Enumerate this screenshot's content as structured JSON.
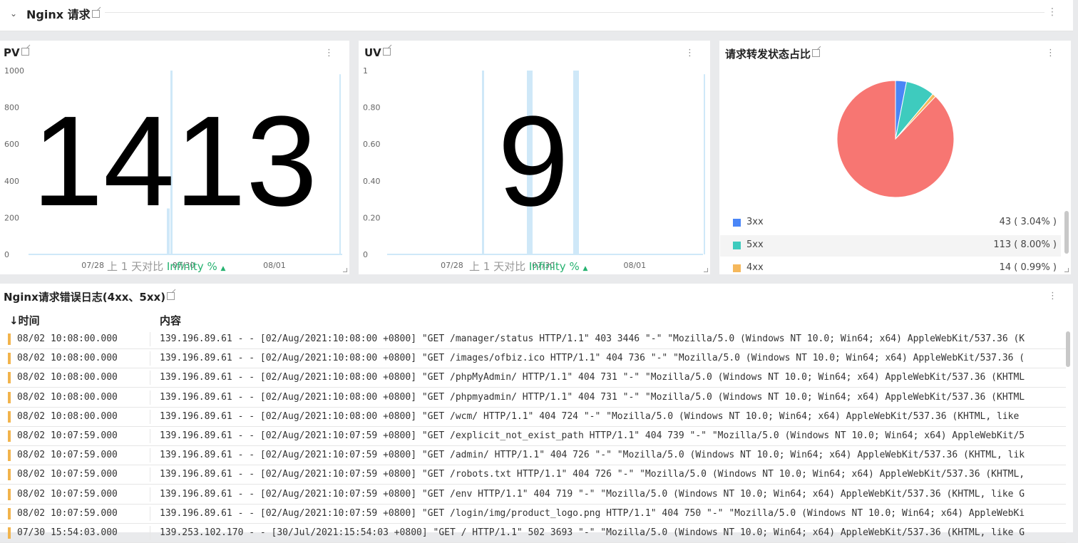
{
  "section": {
    "title": "Nginx 请求"
  },
  "pv_panel": {
    "title": "PV",
    "stat": "1413",
    "y_ticks": [
      "1000",
      "800",
      "600",
      "400",
      "200",
      "0"
    ],
    "x_ticks": [
      "07/28",
      "07/30",
      "08/01"
    ],
    "compare_label": "上 1 天对比",
    "compare_value": "Infinity %",
    "compare_arrow": "▲"
  },
  "uv_panel": {
    "title": "UV",
    "stat": "9",
    "y_ticks": [
      "1",
      "0.80",
      "0.60",
      "0.40",
      "0.20",
      "0"
    ],
    "x_ticks": [
      "07/28",
      "07/30",
      "08/01"
    ],
    "compare_label": "上 1 天对比",
    "compare_value": "Infinity %",
    "compare_arrow": "▲"
  },
  "pie_panel": {
    "title": "请求转发状态占比",
    "legend": [
      {
        "name": "3xx",
        "value": "43 ( 3.04% )",
        "color": "#4a86f7"
      },
      {
        "name": "5xx",
        "value": "113 ( 8.00% )",
        "color": "#3ecbbe"
      },
      {
        "name": "4xx",
        "value": "14 ( 0.99% )",
        "color": "#f5b85c"
      }
    ]
  },
  "chart_data": {
    "type": "pie",
    "slices": [
      {
        "name": "3xx",
        "value": 3.04,
        "color": "#4a86f7"
      },
      {
        "name": "5xx",
        "value": 8.0,
        "color": "#3ecbbe"
      },
      {
        "name": "4xx",
        "value": 0.99,
        "color": "#f5b85c"
      },
      {
        "value": 87.97,
        "color": "#f77672"
      }
    ]
  },
  "log_panel": {
    "title": "Nginx请求错误日志(4xx、5xx)",
    "col_time": "↓时间",
    "col_content": "内容",
    "rows": [
      {
        "time": "08/02 10:08:00.000",
        "content": "139.196.89.61 - - [02/Aug/2021:10:08:00 +0800] \"GET /manager/status HTTP/1.1\" 403 3446 \"-\" \"Mozilla/5.0 (Windows NT 10.0; Win64; x64) AppleWebKit/537.36 (K"
      },
      {
        "time": "08/02 10:08:00.000",
        "content": "139.196.89.61 - - [02/Aug/2021:10:08:00 +0800] \"GET /images/ofbiz.ico HTTP/1.1\" 404 736 \"-\" \"Mozilla/5.0 (Windows NT 10.0; Win64; x64) AppleWebKit/537.36 ("
      },
      {
        "time": "08/02 10:08:00.000",
        "content": "139.196.89.61 - - [02/Aug/2021:10:08:00 +0800] \"GET /phpMyAdmin/ HTTP/1.1\" 404 731 \"-\" \"Mozilla/5.0 (Windows NT 10.0; Win64; x64) AppleWebKit/537.36 (KHTML"
      },
      {
        "time": "08/02 10:08:00.000",
        "content": "139.196.89.61 - - [02/Aug/2021:10:08:00 +0800] \"GET /phpmyadmin/ HTTP/1.1\" 404 731 \"-\" \"Mozilla/5.0 (Windows NT 10.0; Win64; x64) AppleWebKit/537.36 (KHTML"
      },
      {
        "time": "08/02 10:08:00.000",
        "content": "139.196.89.61 - - [02/Aug/2021:10:08:00 +0800] \"GET /wcm/ HTTP/1.1\" 404 724 \"-\" \"Mozilla/5.0 (Windows NT 10.0; Win64; x64) AppleWebKit/537.36 (KHTML, like"
      },
      {
        "time": "08/02 10:07:59.000",
        "content": "139.196.89.61 - - [02/Aug/2021:10:07:59 +0800] \"GET /explicit_not_exist_path HTTP/1.1\" 404 739 \"-\" \"Mozilla/5.0 (Windows NT 10.0; Win64; x64) AppleWebKit/5"
      },
      {
        "time": "08/02 10:07:59.000",
        "content": "139.196.89.61 - - [02/Aug/2021:10:07:59 +0800] \"GET /admin/ HTTP/1.1\" 404 726 \"-\" \"Mozilla/5.0 (Windows NT 10.0; Win64; x64) AppleWebKit/537.36 (KHTML, lik"
      },
      {
        "time": "08/02 10:07:59.000",
        "content": "139.196.89.61 - - [02/Aug/2021:10:07:59 +0800] \"GET /robots.txt HTTP/1.1\" 404 726 \"-\" \"Mozilla/5.0 (Windows NT 10.0; Win64; x64) AppleWebKit/537.36 (KHTML,"
      },
      {
        "time": "08/02 10:07:59.000",
        "content": "139.196.89.61 - - [02/Aug/2021:10:07:59 +0800] \"GET /env HTTP/1.1\" 404 719 \"-\" \"Mozilla/5.0 (Windows NT 10.0; Win64; x64) AppleWebKit/537.36 (KHTML, like G"
      },
      {
        "time": "08/02 10:07:59.000",
        "content": "139.196.89.61 - - [02/Aug/2021:10:07:59 +0800] \"GET /login/img/product_logo.png HTTP/1.1\" 404 750 \"-\" \"Mozilla/5.0 (Windows NT 10.0; Win64; x64) AppleWebKi"
      },
      {
        "time": "07/30 15:54:03.000",
        "content": "139.253.102.170 - - [30/Jul/2021:15:54:03 +0800] \"GET / HTTP/1.1\" 502 3693 \"-\" \"Mozilla/5.0 (Windows NT 10.0; Win64; x64) AppleWebKit/537.36 (KHTML, like G"
      }
    ]
  }
}
